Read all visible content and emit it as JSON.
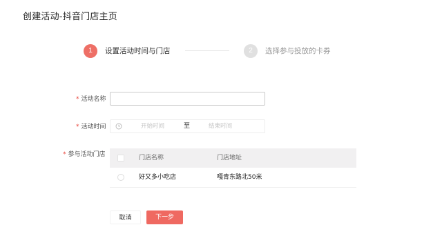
{
  "page": {
    "title": "创建活动-抖音门店主页"
  },
  "steps": [
    {
      "number": "1",
      "label": "设置活动时间与门店",
      "active": true
    },
    {
      "number": "2",
      "label": "选择参与投放的卡券",
      "active": false
    }
  ],
  "form": {
    "name_field": {
      "required_mark": "*",
      "label": "活动名称",
      "value": "",
      "placeholder": ""
    },
    "time_field": {
      "required_mark": "*",
      "label": "活动时间",
      "start_placeholder": "开始时间",
      "separator": "至",
      "end_placeholder": "结束时间",
      "icon": "clock-icon"
    },
    "stores_field": {
      "required_mark": "*",
      "label": "参与活动门店"
    }
  },
  "store_table": {
    "columns": [
      "门店名称",
      "门店地址"
    ],
    "rows": [
      {
        "name": "好又多小吃店",
        "address": "嘎青东路北50米",
        "selected": false
      }
    ]
  },
  "buttons": {
    "cancel": "取消",
    "next": "下一步"
  },
  "colors": {
    "accent": "#ef6961",
    "required": "#e8453c",
    "step_inactive": "#e0e0e0",
    "table_header_bg": "#f1f0f1"
  }
}
